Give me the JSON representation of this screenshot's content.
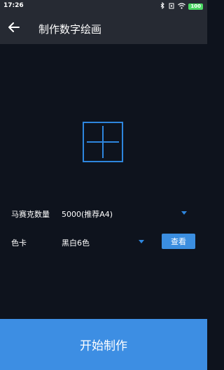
{
  "status": {
    "time": "17:26",
    "battery": "100"
  },
  "header": {
    "title": "制作数字绘画"
  },
  "form": {
    "mosaic_label": "马赛克数量",
    "mosaic_value": "5000(推荐A4)",
    "color_label": "色卡",
    "color_value": "黑白6色",
    "view_label": "查看"
  },
  "footer": {
    "start_label": "开始制作"
  },
  "colors": {
    "accent": "#3d8ee3",
    "background": "#0e131d",
    "bar": "#262a33"
  },
  "icons": [
    "back-arrow-icon",
    "add-image-icon",
    "dropdown-caret-icon",
    "bluetooth-icon",
    "vibrate-icon",
    "wifi-icon",
    "battery-icon"
  ]
}
